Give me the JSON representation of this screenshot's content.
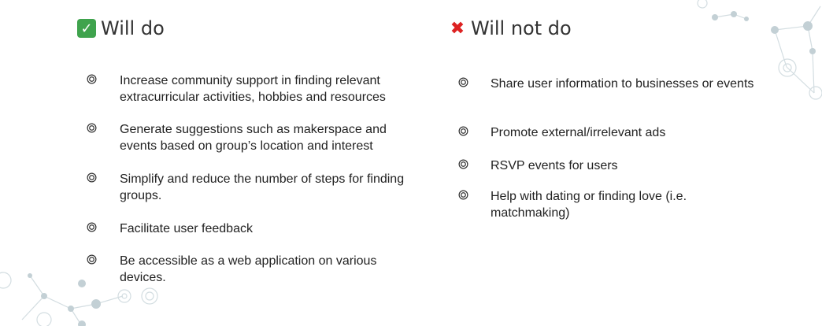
{
  "will_do": {
    "title": "Will do",
    "items": [
      "Increase community support in finding relevant extracurricular activities, hobbies and resources",
      "Generate suggestions such as makerspace and events based on group’s location and interest",
      "Simplify and reduce the number of steps for finding groups.",
      "Facilitate user feedback",
      "Be accessible as a web application on various devices."
    ]
  },
  "will_not_do": {
    "title": "Will not do",
    "items": [
      "Share user information to businesses or events",
      "Promote external/irrelevant ads",
      "RSVP events for users",
      "Help with dating or finding love (i.e. matchmaking)"
    ]
  },
  "colors": {
    "check": "#3fa34d",
    "cross": "#dd2222",
    "decoration": "#c7d3d8"
  }
}
